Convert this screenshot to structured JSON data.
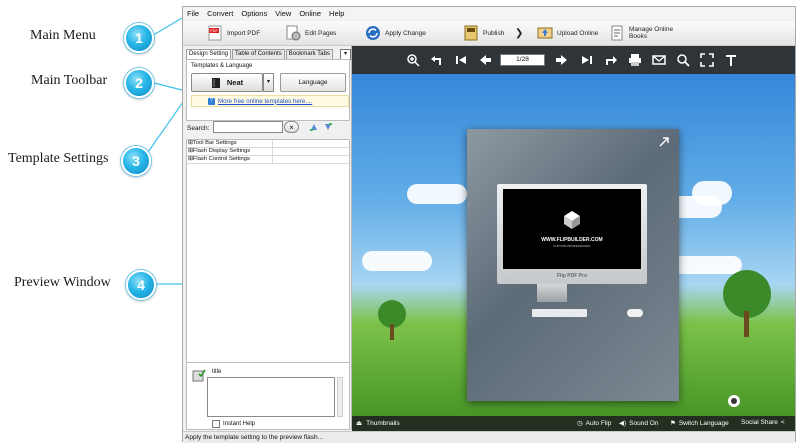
{
  "callouts": [
    {
      "number": "1",
      "label": "Main Menu"
    },
    {
      "number": "2",
      "label": "Main Toolbar"
    },
    {
      "number": "3",
      "label": "Template Settings"
    },
    {
      "number": "4",
      "label": "Preview Window"
    }
  ],
  "menu": [
    "File",
    "Convert",
    "Options",
    "View",
    "Online",
    "Help"
  ],
  "toolbar": {
    "import_pdf": "Import PDF",
    "edit_pages": "Edit Pages",
    "apply_change": "Apply Change",
    "publish": "Publish",
    "more": "❯",
    "upload_online": "Upload Online",
    "manage_books": "Manage Online Books"
  },
  "left_panel": {
    "tabs": [
      "Design Setting",
      "Table of Contents",
      "Bookmark Tabs"
    ],
    "templates_title": "Templates & Language",
    "template_name": "Neat",
    "language_button": "Language",
    "more_templates_link": "More free online templates here....",
    "search_label": "Search:",
    "search_value": "",
    "tree_rows": [
      "Tool Bar Settings",
      "Flash Display Settings",
      "Flash Control Settings"
    ],
    "property_title": "title",
    "instant_help": "Instant Help"
  },
  "preview": {
    "page_indicator": "1/28",
    "screen_title": "WWW.FLIPBUILDER.COM",
    "screen_subtitle": "FLIP PDF PROFESSIONAL",
    "monitor_brand": "Flip PDF Pro",
    "thumbnails": "Thumbnails",
    "auto_flip": "Auto Flip",
    "sound_on": "Sound On",
    "switch_language": "Switch Language",
    "social_share": "Social Share"
  },
  "status": "Apply the template setting to the preview flash...",
  "colors": {
    "callout": "#27b6e8",
    "preview_toolbar": "#2f3438",
    "link": "#1c4fd0"
  }
}
